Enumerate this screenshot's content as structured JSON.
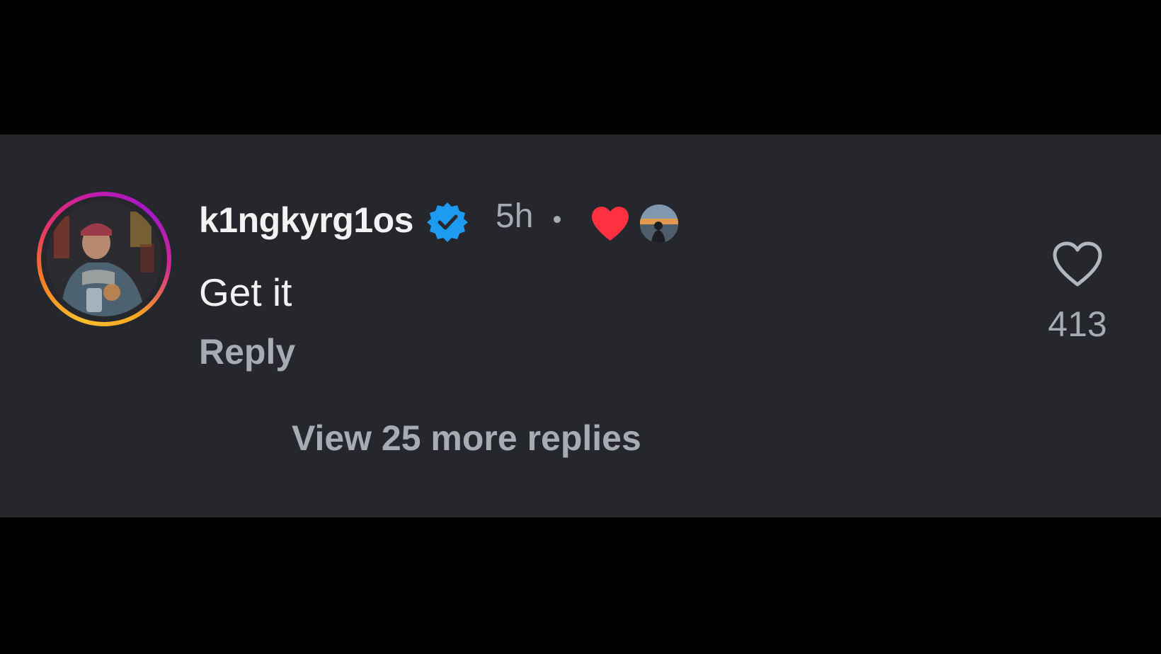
{
  "comment": {
    "username": "k1ngkyrg1os",
    "verified": true,
    "timestamp": "5h",
    "text": "Get it",
    "reply_label": "Reply",
    "like_count": "413",
    "view_replies_label": "View 25 more replies",
    "author_liked": true
  },
  "icons": {
    "verified": "verified-badge-icon",
    "author_heart": "heart-filled-icon",
    "like": "heart-outline-icon"
  },
  "colors": {
    "background": "#25272c",
    "primary_text": "#f2f2f2",
    "secondary_text": "#a8abb2",
    "verified_blue": "#1d9bf0",
    "heart_red": "#ff3040"
  }
}
